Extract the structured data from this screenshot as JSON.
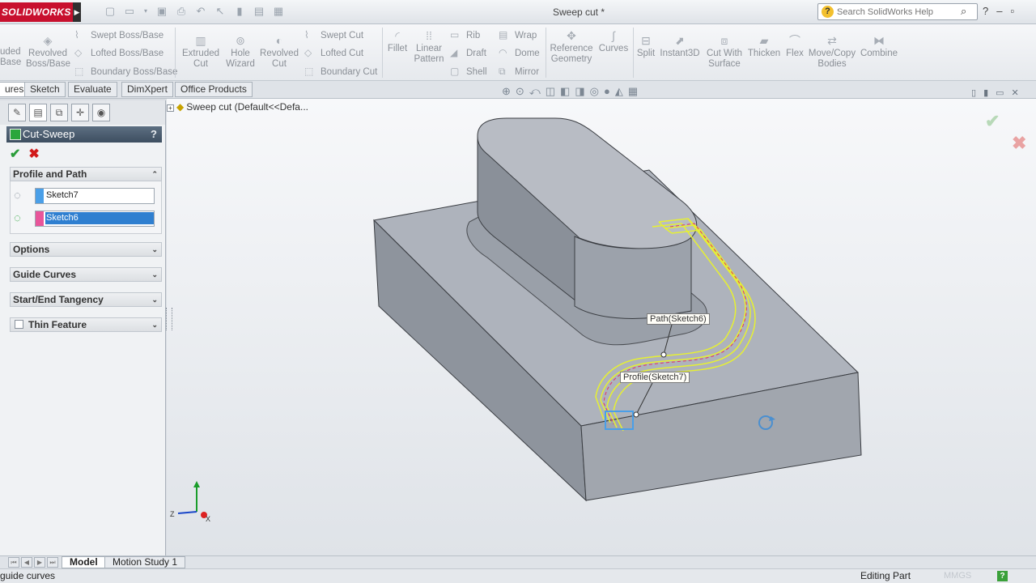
{
  "app": {
    "logo": "SOLIDWORKS",
    "document_title": "Sweep cut *",
    "help_search_placeholder": "Search SolidWorks Help"
  },
  "ribbon": {
    "left_cut_top": "uded",
    "left_cut_bottom": "Base",
    "revolved_boss_base": [
      "Revolved",
      "Boss/Base"
    ],
    "swept_boss_base": "Swept Boss/Base",
    "lofted_boss_base": "Lofted Boss/Base",
    "boundary_boss_base": "Boundary Boss/Base",
    "extruded_cut": [
      "Extruded",
      "Cut"
    ],
    "hole_wizard": [
      "Hole",
      "Wizard"
    ],
    "revolved_cut": [
      "Revolved",
      "Cut"
    ],
    "swept_cut": "Swept Cut",
    "lofted_cut": "Lofted Cut",
    "boundary_cut": "Boundary Cut",
    "fillet": "Fillet",
    "linear_pattern": [
      "Linear",
      "Pattern"
    ],
    "rib": "Rib",
    "draft": "Draft",
    "shell": "Shell",
    "wrap": "Wrap",
    "dome": "Dome",
    "mirror": "Mirror",
    "reference_geometry": [
      "Reference",
      "Geometry"
    ],
    "curves": "Curves",
    "split": "Split",
    "instant3d": "Instant3D",
    "cut_with_surface": [
      "Cut With",
      "Surface"
    ],
    "thicken": "Thicken",
    "flex": "Flex",
    "move_copy_bodies": [
      "Move/Copy",
      "Bodies"
    ],
    "combine": "Combine"
  },
  "tabs": {
    "features_cut": "ures",
    "sketch": "Sketch",
    "evaluate": "Evaluate",
    "dimxpert": "DimXpert",
    "office_products": "Office Products"
  },
  "property_manager": {
    "title": "Cut-Sweep",
    "help": "?",
    "groups": {
      "profile_and_path": "Profile and Path",
      "options": "Options",
      "guide_curves": "Guide Curves",
      "start_end_tangency": "Start/End Tangency",
      "thin_feature": "Thin Feature"
    },
    "profile_value": "Sketch7",
    "path_value": "Sketch6",
    "profile_color": "#4a9fe8",
    "path_color": "#e8559a"
  },
  "viewport": {
    "tree_label": "Sweep cut  (Default<<Defa...",
    "callout_path": "Path(Sketch6)",
    "callout_profile": "Profile(Sketch7)",
    "axis_z": "Z",
    "axis_x": "X"
  },
  "bottom_tabs": {
    "model": "Model",
    "motion_study": "Motion Study 1"
  },
  "status": {
    "message": "guide curves",
    "mode": "Editing Part",
    "units": "MMGS",
    "help": "?"
  },
  "colors": {
    "accent": "#c8102e",
    "selection_highlight": "#2f7fd0",
    "sweep_preview": "#e6f033"
  }
}
